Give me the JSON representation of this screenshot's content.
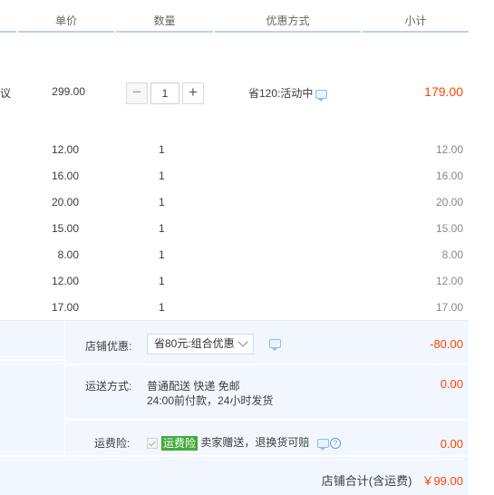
{
  "header": {
    "unit_price": "单价",
    "quantity": "数量",
    "discount_method": "优惠方式",
    "subtotal": "小计"
  },
  "main_item": {
    "name_fragment": "议",
    "price": "299.00",
    "quantity": "1",
    "minus": "−",
    "plus": "+",
    "promotion": "省120:活动中",
    "subtotal": "179.00"
  },
  "sub_items": [
    {
      "price": "12.00",
      "quantity": "1",
      "subtotal": "12.00"
    },
    {
      "price": "16.00",
      "quantity": "1",
      "subtotal": "16.00"
    },
    {
      "price": "20.00",
      "quantity": "1",
      "subtotal": "20.00"
    },
    {
      "price": "15.00",
      "quantity": "1",
      "subtotal": "15.00"
    },
    {
      "price": "8.00",
      "quantity": "1",
      "subtotal": "8.00"
    },
    {
      "price": "12.00",
      "quantity": "1",
      "subtotal": "12.00"
    },
    {
      "price": "17.00",
      "quantity": "1",
      "subtotal": "17.00"
    }
  ],
  "shop": {
    "discount_label": "店铺优惠:",
    "discount_selected": "省80元:组合优惠",
    "discount_amount": "-80.00",
    "shipping_label": "运送方式:",
    "shipping_line1": "普通配送 快递 免邮",
    "shipping_line2": "24:00前付款，24小时发货",
    "shipping_amount": "0.00",
    "insurance_label": "运费险:",
    "insurance_badge": "运费险",
    "insurance_text": "卖家赠送，退换货可赔",
    "insurance_amount": "0.00",
    "help": "?",
    "total_label": "店铺合计(含运费)",
    "total_value": "￥99.00"
  },
  "colors": {
    "accent_red": "#ff4400",
    "header_bar": "#b7d2ec",
    "shop_bg": "#f2f7ff",
    "badge_green": "#44aa3a"
  },
  "icons": [
    "message-icon",
    "chevron-down-icon",
    "checkbox-icon",
    "help-icon"
  ]
}
